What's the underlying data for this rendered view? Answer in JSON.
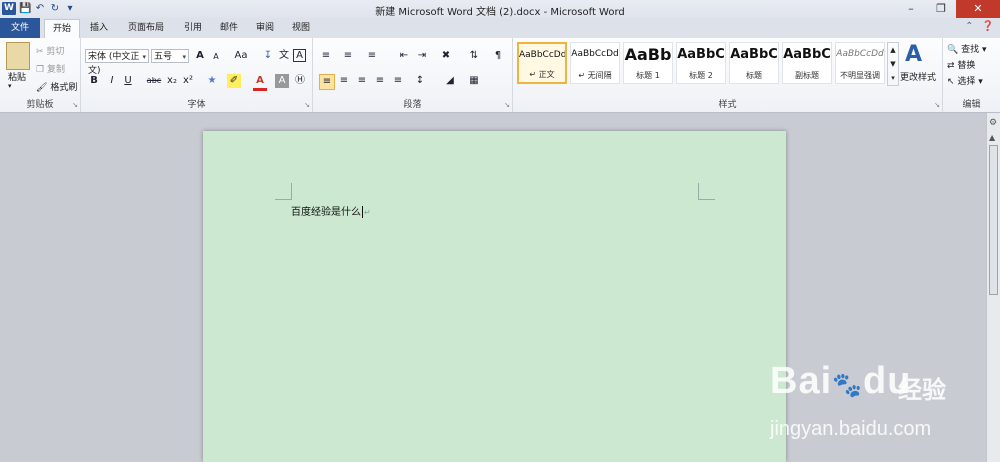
{
  "window": {
    "title": "新建 Microsoft Word 文档 (2).docx - Microsoft Word",
    "app_icon": "W"
  },
  "tabs": {
    "file": "文件",
    "home": "开始",
    "insert": "插入",
    "layout": "页面布局",
    "references": "引用",
    "mailings": "邮件",
    "review": "审阅",
    "view": "视图"
  },
  "clipboard": {
    "paste": "粘贴",
    "cut": "剪切",
    "copy": "复制",
    "format_painter": "格式刷",
    "label": "剪贴板"
  },
  "font": {
    "family": "宋体 (中文正文)",
    "size": "五号",
    "label": "字体",
    "bold": "B",
    "italic": "I",
    "underline": "U",
    "strike": "abc",
    "subscript": "x₂",
    "superscript": "x²",
    "grow": "A",
    "shrink": "A",
    "case": "Aa",
    "color_letter": "A",
    "wen": "文",
    "char_border": "A"
  },
  "paragraph": {
    "label": "段落"
  },
  "styles": {
    "label": "样式",
    "items": [
      {
        "sample": "AaBbCcDd",
        "name": "↵ 正文"
      },
      {
        "sample": "AaBbCcDd",
        "name": "↵ 无间隔"
      },
      {
        "sample": "AaBb",
        "name": "标题 1"
      },
      {
        "sample": "AaBbC",
        "name": "标题 2"
      },
      {
        "sample": "AaBbC",
        "name": "标题"
      },
      {
        "sample": "AaBbC",
        "name": "副标题"
      },
      {
        "sample": "AaBbCcDd",
        "name": "不明显强调"
      }
    ],
    "change_styles": "更改样式"
  },
  "editing": {
    "label": "编辑",
    "find": "查找",
    "replace": "替换",
    "select": "选择"
  },
  "document": {
    "text": "百度经验是什么"
  },
  "watermark": {
    "brand": "Bai",
    "brand2": "du",
    "cn": "经验",
    "url": "jingyan.baidu.com"
  },
  "colors": {
    "file_tab": "#2b579a",
    "page_bg": "#cce8d0",
    "selected_style": "#f0b43c",
    "close_button": "#c0392b"
  }
}
